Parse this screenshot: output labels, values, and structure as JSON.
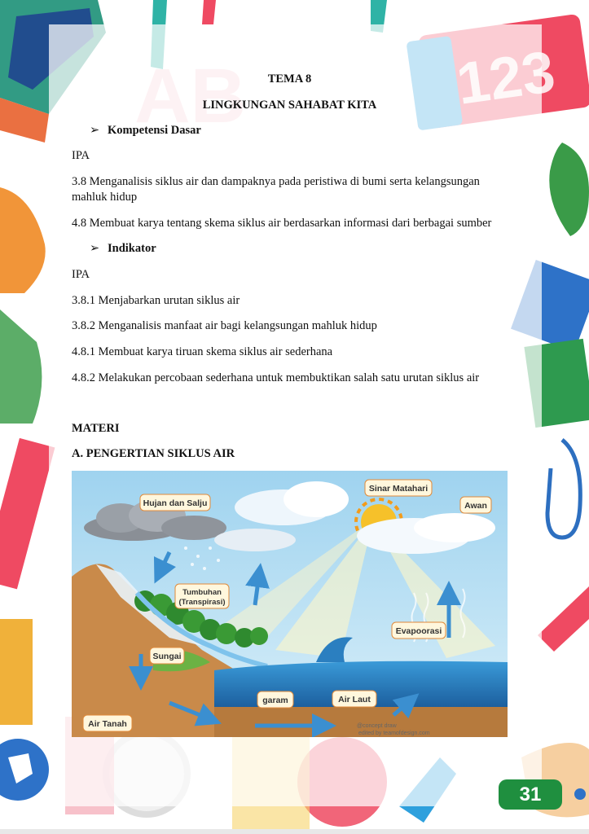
{
  "header": {
    "tema": "TEMA 8",
    "title": "LINGKUNGAN SAHABAT KITA"
  },
  "kompetensi": {
    "heading": "Kompetensi Dasar",
    "subject": "IPA",
    "items": [
      "3.8 Menganalisis siklus air dan dampaknya pada peristiwa di bumi serta kelangsungan",
      "mahluk hidup",
      "4.8 Membuat karya tentang skema siklus air berdasarkan informasi dari berbagai sumber"
    ]
  },
  "indikator": {
    "heading": "Indikator",
    "subject": "IPA",
    "items": [
      "3.8.1 Menjabarkan urutan siklus air",
      "3.8.2 Menganalisis manfaat air bagi kelangsungan mahluk hidup",
      "4.8.1 Membuat karya tiruan skema siklus air sederhana",
      "4.8.2 Melakukan percobaan sederhana untuk membuktikan salah satu urutan siklus air"
    ]
  },
  "materi": {
    "heading": "MATERI",
    "section": "A.  PENGERTIAN SIKLUS AIR"
  },
  "diagram": {
    "labels": {
      "hujan": "Hujan dan Salju",
      "matahari": "Sinar Matahari",
      "awan": "Awan",
      "tumbuhan_1": "Tumbuhan",
      "tumbuhan_2": "(Transpirasi)",
      "evaporasi": "Evapoorasi",
      "sungai": "Sungai",
      "garam": "garam",
      "air_laut": "Air Laut",
      "air_tanah": "Air Tanah"
    },
    "watermark_1": "@concept draw",
    "watermark_2": "edited by teamofdesign.com"
  },
  "footer": {
    "page_number": "31"
  },
  "colors": {
    "badge": "#1f8f3f",
    "ocean": "#2e86c8",
    "ground": "#c98a4a",
    "trees": "#2f8a2f",
    "arrow": "#3b8fd0"
  }
}
